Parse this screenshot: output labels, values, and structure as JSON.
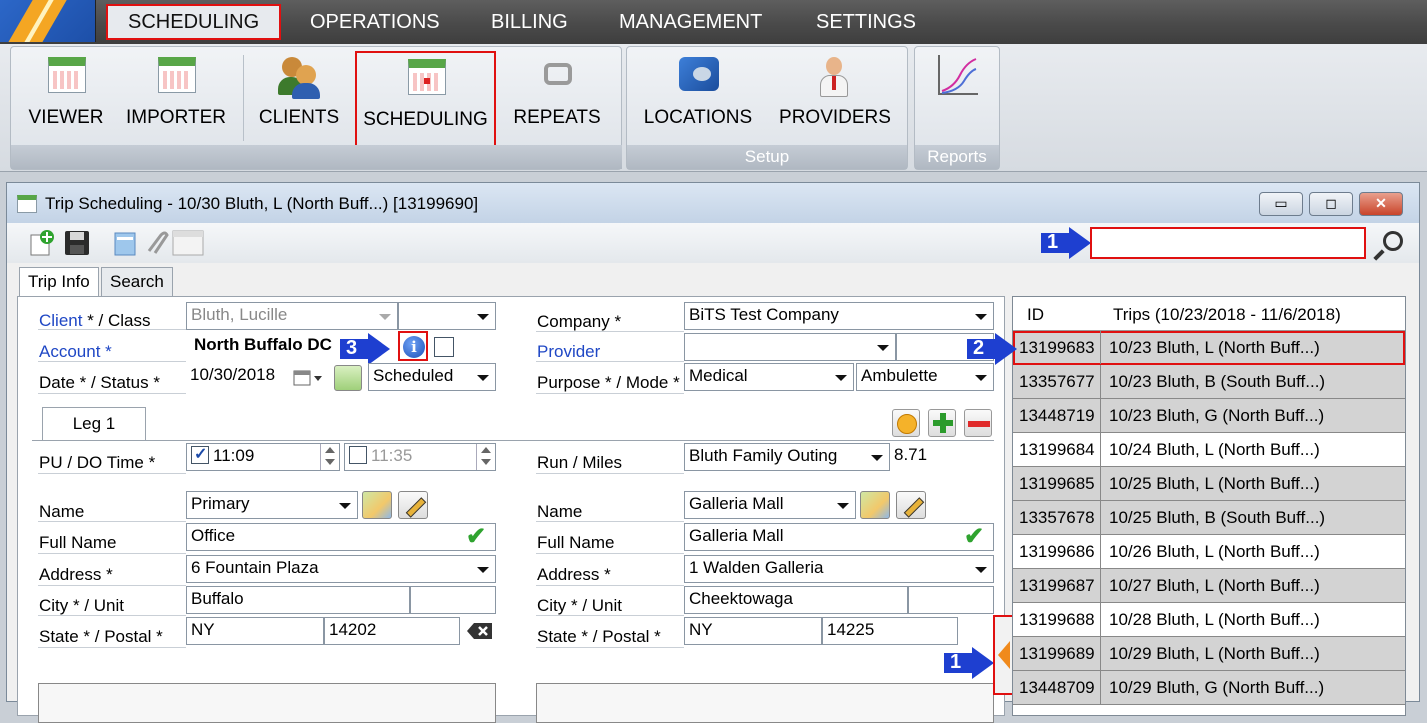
{
  "menu": {
    "items": [
      "SCHEDULING",
      "OPERATIONS",
      "BILLING",
      "MANAGEMENT",
      "SETTINGS"
    ]
  },
  "ribbon": {
    "buttons": [
      "VIEWER",
      "IMPORTER",
      "CLIENTS",
      "SCHEDULING",
      "REPEATS",
      "LOCATIONS",
      "PROVIDERS"
    ],
    "setup_label": "Setup",
    "reports_label": "Reports"
  },
  "window": {
    "title": "Trip Scheduling - 10/30 Bluth, L (North Buff...) [13199690]",
    "minimize": "▭",
    "restore": "◻",
    "close": "✕"
  },
  "tabs": [
    "Trip Info",
    "Search"
  ],
  "search": {
    "placeholder": ""
  },
  "form": {
    "client_label": "Client",
    "client_label_rest": " * / Class",
    "client_value": "Bluth, Lucille",
    "class_value": "",
    "account_label": "Account *",
    "account_value": "North Buffalo DC",
    "date_label": "Date * / Status *",
    "date_value": "10/30/2018",
    "status_value": "Scheduled",
    "company_label": "Company *",
    "company_value": "BiTS Test Company",
    "provider_label": "Provider",
    "provider_value": "",
    "purpose_label": "Purpose * / Mode *",
    "purpose_value": "Medical",
    "mode_value": "Ambulette",
    "leg_tab": "Leg 1",
    "pudo_label": "PU / DO Time *",
    "pu_time": "11:09",
    "do_time": "11:35",
    "run_label": "Run / Miles",
    "run_value": "Bluth Family Outing",
    "miles_value": "8.71",
    "pickup": {
      "name_label": "Name",
      "name_value": "Primary",
      "fullname_label": "Full Name",
      "fullname_value": "Office",
      "address_label": "Address *",
      "address_value": "6 Fountain Plaza",
      "city_label": "City * / Unit",
      "city_value": "Buffalo",
      "state_label": "State * / Postal *",
      "state_value": "NY",
      "postal_value": "14202"
    },
    "dropoff": {
      "name_label": "Name",
      "name_value": "Galleria Mall",
      "fullname_label": "Full Name",
      "fullname_value": "Galleria Mall",
      "address_label": "Address *",
      "address_value": "1 Walden Galleria",
      "city_label": "City * / Unit",
      "city_value": "Cheektowaga",
      "state_label": "State * / Postal *",
      "state_value": "NY",
      "postal_value": "14225"
    }
  },
  "annotations": {
    "a1": "1",
    "a2": "2",
    "a3": "3",
    "a1b": "1"
  },
  "trips": {
    "col_id": "ID",
    "col_desc": "Trips (10/23/2018 - 11/6/2018)",
    "rows": [
      {
        "id": "13199683",
        "desc": "10/23 Bluth, L (North Buff...)"
      },
      {
        "id": "13357677",
        "desc": "10/23 Bluth, B (South Buff...)"
      },
      {
        "id": "13448719",
        "desc": "10/23 Bluth, G (North Buff...)"
      },
      {
        "id": "13199684",
        "desc": "10/24 Bluth, L (North Buff...)"
      },
      {
        "id": "13199685",
        "desc": "10/25 Bluth, L (North Buff...)"
      },
      {
        "id": "13357678",
        "desc": "10/25 Bluth, B (South Buff...)"
      },
      {
        "id": "13199686",
        "desc": "10/26 Bluth, L (North Buff...)"
      },
      {
        "id": "13199687",
        "desc": "10/27 Bluth, L (North Buff...)"
      },
      {
        "id": "13199688",
        "desc": "10/28 Bluth, L (North Buff...)"
      },
      {
        "id": "13199689",
        "desc": "10/29 Bluth, L (North Buff...)"
      },
      {
        "id": "13448709",
        "desc": "10/29 Bluth, G (North Buff...)"
      }
    ]
  },
  "colors": {
    "accent_red": "#e01010",
    "arrow_blue": "#1e3fd0",
    "link_blue": "#1f47c5"
  }
}
